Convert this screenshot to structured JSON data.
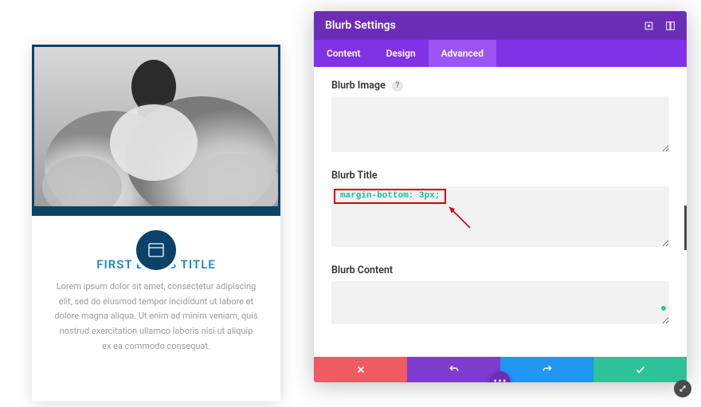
{
  "blurb": {
    "title": "FIRST BLURB TITLE",
    "description": "Lorem ipsum dolor sit amet, consectetur adipiscing elit, sed do eiusmod tempor incididunt ut labore et dolore magna aliqua. Ut enim ad minim veniam, quis nostrud exercitation ullamco laboris nisi ut aliquip ex ea commodo consequat."
  },
  "panel": {
    "title": "Blurb Settings",
    "tabs": {
      "content": "Content",
      "design": "Design",
      "advanced": "Advanced"
    },
    "fields": {
      "image": {
        "label": "Blurb Image",
        "help": "?",
        "value": ""
      },
      "title": {
        "label": "Blurb Title",
        "value": "margin-bottom: 3px;"
      },
      "content": {
        "label": "Blurb Content",
        "value": ""
      }
    }
  },
  "colors": {
    "brand": "#0b426a",
    "purple_dark": "#6c2eb9",
    "purple": "#8033e6",
    "purple_light": "#9a55f3",
    "danger": "#ef5a63",
    "info": "#2196f3",
    "success": "#2fc198"
  }
}
